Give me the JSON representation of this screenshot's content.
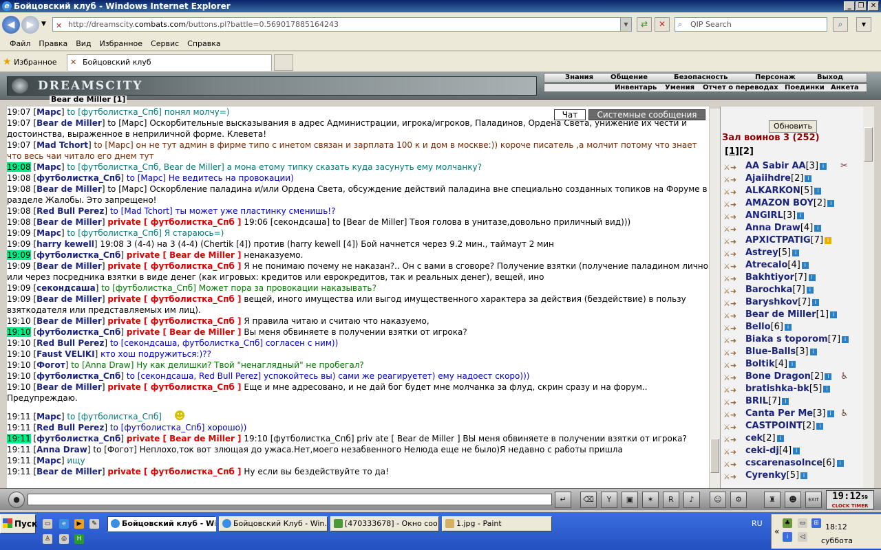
{
  "window": {
    "title": "Бойцовский клуб - Windows Internet Explorer"
  },
  "nav": {
    "url_prefix": "http://dreamscity.",
    "url_domain": "combats.com",
    "url_suffix": "/buttons.pl?battle=0.569017885164243",
    "search_placeholder": "QIP Search"
  },
  "menu": [
    "Файл",
    "Правка",
    "Вид",
    "Избранное",
    "Сервис",
    "Справка"
  ],
  "favorites": {
    "label": "Избранное",
    "tab_title": "Бойцовский клуб"
  },
  "game": {
    "logo": "DREAMSCITY",
    "menu_top": [
      "Знания",
      "Общение",
      "Безопасность",
      "Персонаж",
      "Выход"
    ],
    "menu_bottom": [
      "Инвентарь",
      "Умения",
      "Отчет о переводах",
      "Поединки",
      "Анкета"
    ],
    "player": "Bear de Miller [1]"
  },
  "chat_tabs": [
    "Чат",
    "Системные сообщения"
  ],
  "chat": [
    {
      "t": "19:07",
      "n": "Марс",
      "to": "to [футболистка_Спб]",
      "msg": "понял молчу=)",
      "c": "tl"
    },
    {
      "t": "19:07",
      "n": "Bear de Miller",
      "to": "to [Марс]",
      "msg": "Оскорбительные высказывания в адрес Администрации, игрока/игроков, Паладинов, Ордена Света, унижение их чести и достоинства, выраженное в неприличной форме. Клевета!",
      "c": "t",
      "wrap": true
    },
    {
      "t": "19:07",
      "n": "Mad Tchort",
      "to": "to [Марс]",
      "msg": "он не тут админ в фирме типо с инетом связан и зарплата 100 к и дом в москве:)) короче писатель ,а молчит потому что знает что весь чаи читало его днем тут",
      "c": "br",
      "wrap": true
    },
    {
      "t": "19:08",
      "th": true,
      "n": "Марс",
      "to": "to [футболистка_Спб, Bear de Miller]",
      "msg": "а мона етому типку сказать куда засунуть ему молчанку?",
      "c": "tl"
    },
    {
      "t": "19:08",
      "n": "футболистка_Спб",
      "to": "to [Марс]",
      "msg": "Не ведитесь на провокации)",
      "c": "bl"
    },
    {
      "t": "19:08",
      "n": "Bear de Miller",
      "to": "to [Марс]",
      "msg": "Оскорбление паладина и/или Ордена Света, обсуждение действий паладина вне специально созданных топиков на Форуме в разделе Жалобы. Это запрещено!",
      "c": "t",
      "wrap": true
    },
    {
      "t": "19:08",
      "n": "Red Bull Perez",
      "to": "to [Mad Tchort]",
      "msg": "ты может уже пластинку сменишь!?",
      "c": "bl"
    },
    {
      "t": "19:08",
      "n": "Bear de Miller",
      "pv": "private [ футболистка_Спб ]",
      "msg": "19:06 [секондсаша] to [Bear de Miller] Твоя голова в унитазе,довольно приличный вид)))",
      "c": "t"
    },
    {
      "t": "19:09",
      "n": "Марс",
      "to": "to [футболистка_Спб]",
      "msg": "Я стараюсь=)",
      "c": "tl"
    },
    {
      "t": "19:09",
      "n": "harry kewell",
      "to": "",
      "msg": "19:08 3 (4-4) на 3 (4-4) (Chertik [4]) против (harry kewell [4]) Бой начнется через 9.2 мин., таймаут 2 мин",
      "c": "t"
    },
    {
      "t": "19:09",
      "th": true,
      "n": "футболистка_Спб",
      "pv": "private [ Bear de Miller ]",
      "msg": "ненаказуемо.",
      "c": "t"
    },
    {
      "t": "19:09",
      "n": "Bear de Miller",
      "pv": "private [ футболистка_Спб ]",
      "msg": "Я не понимаю почему не наказан?.. Он с вами в сговоре? Получение взятки (получение паладином лично или через посредника взятки в виде денег (как игровых: кредитов или еврокредитов, так и реальных денег), вещей, ино",
      "c": "t",
      "wrap": true
    },
    {
      "t": "19:09",
      "n": "секондсаша",
      "to": "to [футболистка_Спб]",
      "msg": "Может пора за провокации наказывать?",
      "c": "g"
    },
    {
      "t": "19:09",
      "n": "Bear de Miller",
      "pv": "private [ футболистка_Спб ]",
      "msg": "вещей, иного имущества или выгод имущественного характера за действия (бездействие) в пользу взяткодателя или представляемых им лиц).",
      "c": "t",
      "wrap": true
    },
    {
      "t": "19:10",
      "n": "Bear de Miller",
      "pv": "private [ футболистка_Спб ]",
      "msg": "Я правила читаю и считаю что наказуемо,",
      "c": "t"
    },
    {
      "t": "19:10",
      "th": true,
      "n": "футболистка_Спб",
      "pv": "private [ Bear de Miller ]",
      "msg": "Вы меня обвиняете в получении взятки от игрока?",
      "c": "t"
    },
    {
      "t": "19:10",
      "n": "Red Bull Perez",
      "to": "to [секондсаша, футболистка_Спб]",
      "msg": "согласен с ним))",
      "c": "bl"
    },
    {
      "t": "19:10",
      "n": "Faust VELIKI",
      "to": "",
      "msg": "кто хош подружиться:)??",
      "c": "bl"
    },
    {
      "t": "19:10",
      "n": "Фогот",
      "to": "to [Anna Draw]",
      "msg": "Ну как делишки? Твой \"ненаглядный\" не пробегал?",
      "c": "g"
    },
    {
      "t": "19:10",
      "n": "футболистка_Спб",
      "to": "to [секондсаша, Red Bull Perez]",
      "msg": "успокойтесь вы) сами же реагируетет) ему надоест скоро)))",
      "c": "bl"
    },
    {
      "t": "19:10",
      "n": "Bear de Miller",
      "pv": "private [ футболистка_Спб ]",
      "msg": "Еще и мне адресовано, и не дай бог будет мне молчанка за флуд, скрин сразу и на форум.. Предупреждаю.",
      "c": "t",
      "wrap": true
    },
    {
      "t": "",
      "n": "",
      "msg": "",
      "c": "t",
      "blank": true
    },
    {
      "t": "19:11",
      "n": "Марс",
      "to": "to [футболистка_Спб]",
      "msg": "",
      "c": "tl",
      "smiley": true
    },
    {
      "t": "19:11",
      "n": "Red Bull Perez",
      "to": "to [футболистка_Спб]",
      "msg": "хорошо))",
      "c": "bl"
    },
    {
      "t": "19:11",
      "th": true,
      "n": "футболистка_Спб",
      "pv": "private [ Bear de Miller ]",
      "msg": "19:10 [футболистка_Спб] priv ate [ Bear de Miller ] ВЫ меня обвиняете в получении взятки от игрока?",
      "c": "t",
      "wrap": true
    },
    {
      "t": "19:11",
      "n": "Anna Draw",
      "to": "to [Фогот]",
      "msg": "Неплохо,ток вот злющая до ужаса.Нет,моего незабвенного Нелюда еще не было)Я недавно с работы пришла",
      "c": "t"
    },
    {
      "t": "19:11",
      "n": "Марс",
      "to": "",
      "msg": "ищу",
      "c": "tl"
    },
    {
      "t": "19:11",
      "n": "Bear de Miller",
      "pv": "private [ футболистка_Спб ]",
      "msg": "Ну если вы бездействуйте то да!",
      "c": "t"
    }
  ],
  "panel": {
    "refresh": "Обновить",
    "hall": "Зал воинов 3 (252)",
    "pages": [
      "1",
      "2"
    ],
    "users": [
      {
        "n": "AA Sabir AA",
        "l": "[3]",
        "ex": "✂"
      },
      {
        "n": "Ajaiihdre",
        "l": "[2]"
      },
      {
        "n": "ALKARKON",
        "l": "[5]"
      },
      {
        "n": "AMAZON BOY",
        "l": "[2]"
      },
      {
        "n": "ANGIRL",
        "l": "[3]"
      },
      {
        "n": "Anna Draw",
        "l": "[4]"
      },
      {
        "n": "APXICTPATIG",
        "l": "[7]",
        "y": true
      },
      {
        "n": "Astrey",
        "l": "[5]"
      },
      {
        "n": "Atrecalo",
        "l": "[4]"
      },
      {
        "n": "Bakhtiyor",
        "l": "[7]"
      },
      {
        "n": "Barochka",
        "l": "[7]"
      },
      {
        "n": "Baryshkov",
        "l": "[7]"
      },
      {
        "n": "Bear de Miller",
        "l": "[1]"
      },
      {
        "n": "Bello",
        "l": "[6]"
      },
      {
        "n": "Biaka s toporom",
        "l": "[7]"
      },
      {
        "n": "Blue-Balls",
        "l": "[3]"
      },
      {
        "n": "Boltik",
        "l": "[4]"
      },
      {
        "n": "Bone Dragon",
        "l": "[2]",
        "ex": "♿"
      },
      {
        "n": "bratishka-bk",
        "l": "[5]"
      },
      {
        "n": "BRIL",
        "l": "[7]"
      },
      {
        "n": "Canta Per Me",
        "l": "[3]",
        "ex": "♿"
      },
      {
        "n": "CASTPOINT",
        "l": "[2]"
      },
      {
        "n": "cek",
        "l": "[2]"
      },
      {
        "n": "ceki-dj",
        "l": "[4]"
      },
      {
        "n": "cscarenasolnce",
        "l": "[6]"
      },
      {
        "n": "Cyrenky",
        "l": "[5]"
      }
    ]
  },
  "clock": {
    "time": "19:12",
    "sec": "59",
    "label": "CLOCK TIMER"
  },
  "taskbar": {
    "start": "Пуск",
    "tasks": [
      "Бойцовский клуб - Wi...",
      "Бойцовский Клуб - Win...",
      "[470333678] - Окно соо...",
      "1.jpg - Paint"
    ],
    "lang": "RU",
    "time": "18:12",
    "day": "суббота"
  }
}
